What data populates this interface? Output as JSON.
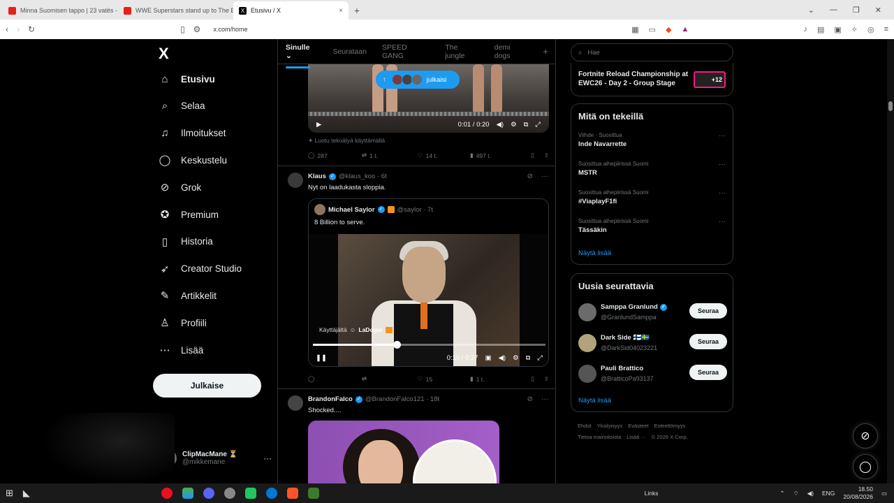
{
  "browser": {
    "tabs": [
      {
        "title": "Minna Suomisen tappo | 23 vatës - H",
        "color": "#e62117"
      },
      {
        "title": "WWE Superstars stand up to The Blo",
        "color": "#e62117"
      },
      {
        "title": "Etusivu / X",
        "color": "#000000"
      }
    ],
    "url": "x.com/home"
  },
  "nav": {
    "logo": "X",
    "items": [
      {
        "label": "Etusivu",
        "icon": "home-icon",
        "glyph": "⌂"
      },
      {
        "label": "Selaa",
        "icon": "search-icon",
        "glyph": "⌕"
      },
      {
        "label": "Ilmoitukset",
        "icon": "bell-icon",
        "glyph": "♫"
      },
      {
        "label": "Keskustelu",
        "icon": "chat-icon",
        "glyph": "◯"
      },
      {
        "label": "Grok",
        "icon": "grok-icon",
        "glyph": "⊘"
      },
      {
        "label": "Premium",
        "icon": "premium-icon",
        "glyph": "✪"
      },
      {
        "label": "Historia",
        "icon": "bookmark-icon",
        "glyph": "▯"
      },
      {
        "label": "Creator Studio",
        "icon": "rocket-icon",
        "glyph": "➶"
      },
      {
        "label": "Artikkelit",
        "icon": "article-icon",
        "glyph": "✎"
      },
      {
        "label": "Profiili",
        "icon": "profile-icon",
        "glyph": "♙"
      },
      {
        "label": "Lisää",
        "icon": "more-icon",
        "glyph": "⋯"
      }
    ],
    "post_button": "Julkaise",
    "account": {
      "name": "ClipMacMane ⏳",
      "handle": "@mikkemane"
    }
  },
  "timeline": {
    "tabs": [
      "Sinulle",
      "Seurataan",
      "SPEED GANG",
      "The jungle",
      "demi dogs"
    ],
    "new_posts_pill": "julkaisi",
    "video1": {
      "time": "0:01 / 0:20",
      "ai_note": "Luotu tekoälyä käyttämällä",
      "replies": "287",
      "reposts": "1 t.",
      "likes": "14 t.",
      "views": "497 t."
    },
    "post2": {
      "name": "Klaus",
      "handle": "@klaus_koo · 6t",
      "text": "Nyt on laadukasta sloppia.",
      "quote": {
        "name": "Michael Saylor",
        "handle": "@saylor · 7t",
        "text": "8 Billion to serve."
      },
      "video": {
        "user_label_prefix": "Käyttäjältä",
        "user_label_name": "LaDoger",
        "time": "0:10 / 0:27",
        "progress": 0.36
      },
      "replies": "",
      "reposts": "",
      "likes": "15",
      "views": "1 t."
    },
    "post3": {
      "name": "BrandonFalco",
      "handle": "@BrandonFalco121 · 18t",
      "text": "Shocked...."
    }
  },
  "right": {
    "search_placeholder": "Hae",
    "event": {
      "title": "Fortnite Reload Championship at EWC26 - Day 2 - Group Stage",
      "badge": "+12"
    },
    "trends_title": "Mitä on tekeillä",
    "trends": [
      {
        "context": "Viihde · Suosittua",
        "title": "Inde Navarrette"
      },
      {
        "context": "Suosittua aihepiirissä Suomi",
        "title": "MSTR"
      },
      {
        "context": "Suosittua aihepiirissä Suomi",
        "title": "#ViaplayF1fi"
      },
      {
        "context": "Suosittua aihepiirissä Suomi",
        "title": "Tässäkin"
      }
    ],
    "trends_more": "Näytä lisää",
    "who_title": "Uusia seurattavia",
    "who": [
      {
        "name": "Samppa Granlund",
        "handle": "@GranlundSamppa",
        "verified": true
      },
      {
        "name": "Dark Side 🇫🇮🇸🇪",
        "handle": "@DarkSid04023221",
        "verified": false
      },
      {
        "name": "Pauli Brattico",
        "handle": "@BratticoPa93137",
        "verified": false
      }
    ],
    "follow_label": "Seuraa",
    "who_more": "Näytä lisää",
    "footer1": [
      "Ehdot",
      "Yksityisyys",
      "Evästeet",
      "Esteettömyys"
    ],
    "footer2": [
      "Tietoa mainoksista",
      "Lisää ···",
      "© 2026 X Corp."
    ]
  },
  "taskbar": {
    "links": "Links",
    "lang": "ENG",
    "time": "18.50",
    "date": "20/08/2026"
  },
  "colors": {
    "accent": "#1d9bf0",
    "bg": "#000000",
    "border": "#2f3336",
    "muted": "#71767b"
  }
}
